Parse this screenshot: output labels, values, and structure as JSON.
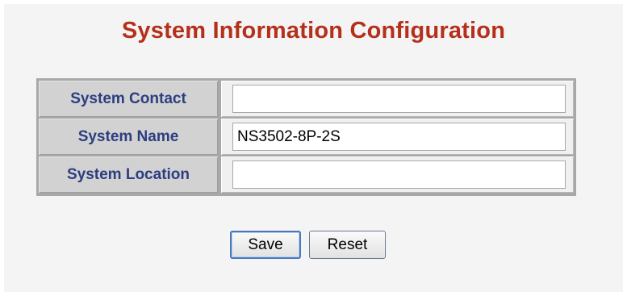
{
  "page": {
    "title": "System Information Configuration"
  },
  "form": {
    "rows": [
      {
        "label": "System Contact",
        "value": "",
        "placeholder": ""
      },
      {
        "label": "System Name",
        "value": "NS3502-8P-2S",
        "placeholder": ""
      },
      {
        "label": "System Location",
        "value": "",
        "placeholder": ""
      }
    ]
  },
  "actions": {
    "save_label": "Save",
    "reset_label": "Reset"
  },
  "colors": {
    "title": "#b5301c",
    "label_text": "#2c3e80",
    "label_background": "#d2d2d2",
    "panel_background": "#f4f4f4",
    "focus_border": "#4a78c0"
  }
}
